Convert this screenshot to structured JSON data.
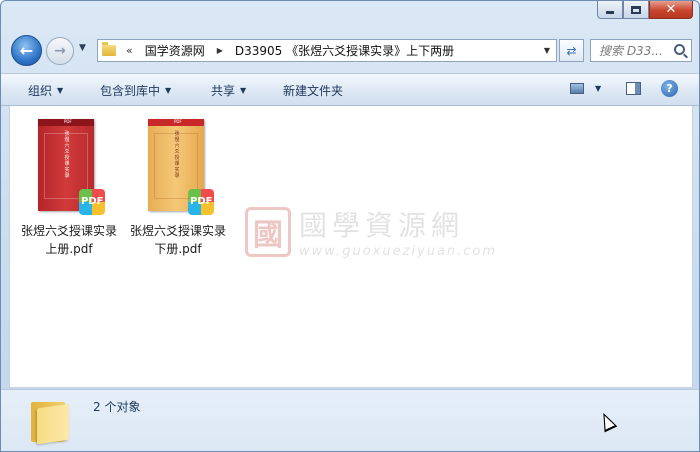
{
  "window": {
    "caption": {
      "minimize": "minimize",
      "maximize": "maximize",
      "close": "✕"
    }
  },
  "nav": {
    "back_symbol": "←",
    "forward_symbol": "→",
    "address": {
      "chevron": "«",
      "segments": [
        "国学资源网",
        "D33905 《张煜六爻授课实录》上下两册"
      ]
    },
    "refresh_symbol": "⇄",
    "search": {
      "placeholder": "搜索 D33..."
    }
  },
  "toolbar": {
    "organize": "组织",
    "include_in_library": "包含到库中",
    "share": "共享",
    "new_folder": "新建文件夹"
  },
  "files": [
    {
      "name_line1": "张煜六爻授课实录",
      "name_line2": "上册.pdf",
      "cover_label": "PDF",
      "cover_title": "张煜六爻授课实录",
      "badge": "PDF",
      "cover_color": "#c12f33"
    },
    {
      "name_line1": "张煜六爻授课实录",
      "name_line2": "下册.pdf",
      "cover_label": "PDF",
      "cover_title": "张煜六爻授课实录",
      "badge": "PDF",
      "cover_color": "#f0bd69"
    }
  ],
  "watermark": {
    "seal": "國",
    "cn": "國學資源網",
    "en": "www.guoxueziyuan.com"
  },
  "details": {
    "count": "2 个对象"
  }
}
